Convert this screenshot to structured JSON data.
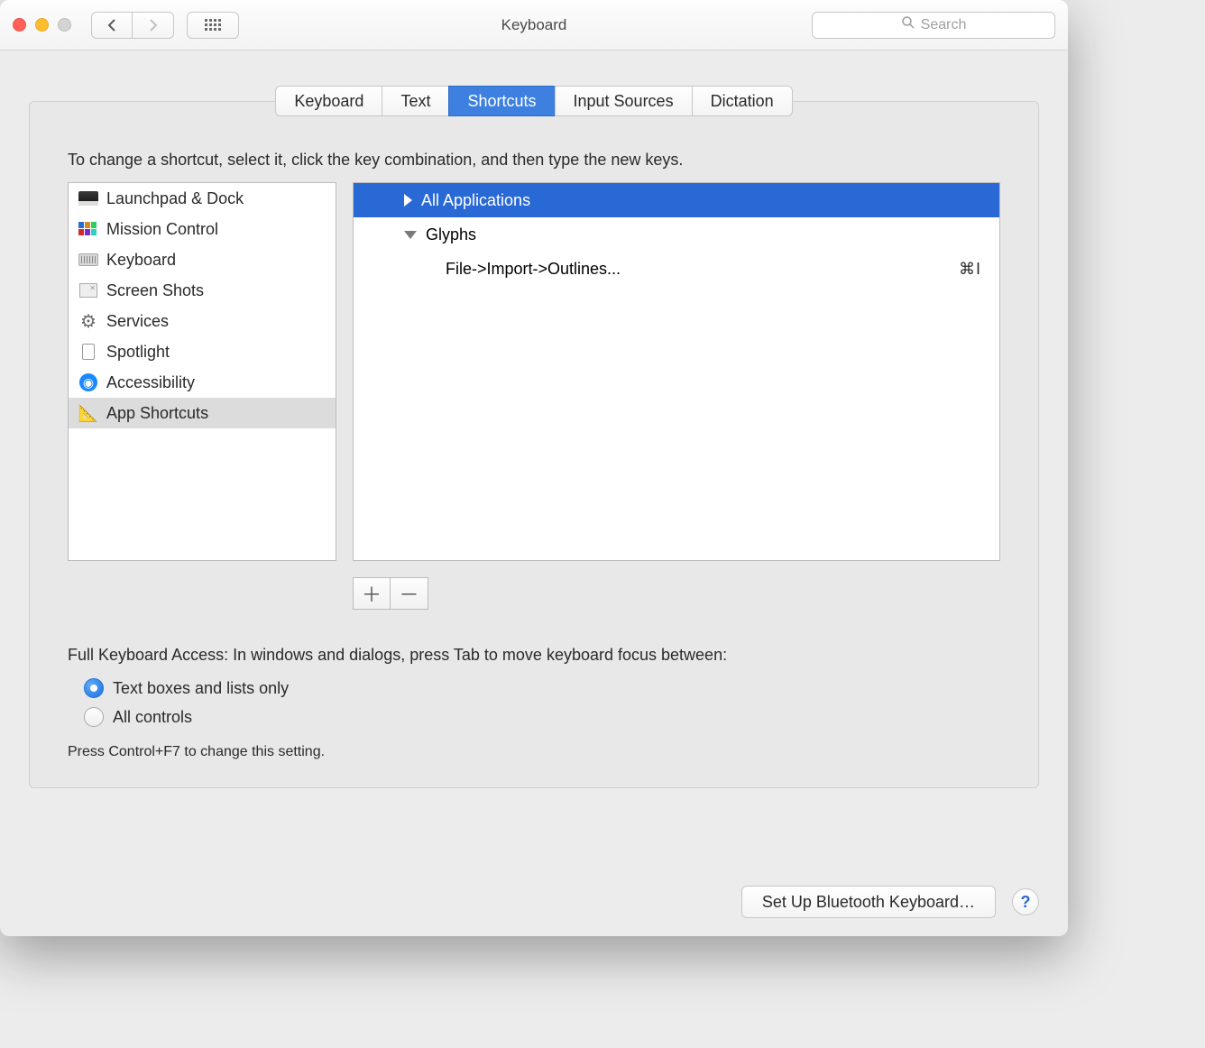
{
  "window": {
    "title": "Keyboard",
    "search_placeholder": "Search"
  },
  "tabs": [
    {
      "label": "Keyboard",
      "active": false
    },
    {
      "label": "Text",
      "active": false
    },
    {
      "label": "Shortcuts",
      "active": true
    },
    {
      "label": "Input Sources",
      "active": false
    },
    {
      "label": "Dictation",
      "active": false
    }
  ],
  "instructions": "To change a shortcut, select it, click the key combination, and then type the new keys.",
  "categories": [
    {
      "label": "Launchpad & Dock",
      "icon": "launchpad",
      "selected": false
    },
    {
      "label": "Mission Control",
      "icon": "mission",
      "selected": false
    },
    {
      "label": "Keyboard",
      "icon": "keyboard",
      "selected": false
    },
    {
      "label": "Screen Shots",
      "icon": "screenshots",
      "selected": false
    },
    {
      "label": "Services",
      "icon": "gear",
      "selected": false
    },
    {
      "label": "Spotlight",
      "icon": "spotlight",
      "selected": false
    },
    {
      "label": "Accessibility",
      "icon": "accessibility",
      "selected": false
    },
    {
      "label": "App Shortcuts",
      "icon": "app",
      "selected": true
    }
  ],
  "tree": {
    "all_apps_label": "All Applications",
    "glyphs_label": "Glyphs",
    "glyphs_item_label": "File->Import->Outlines...",
    "glyphs_item_shortcut": "⌘I"
  },
  "fka": {
    "label": "Full Keyboard Access: In windows and dialogs, press Tab to move keyboard focus between:",
    "option1": "Text boxes and lists only",
    "option2": "All controls",
    "hint": "Press Control+F7 to change this setting."
  },
  "footer": {
    "bluetooth_label": "Set Up Bluetooth Keyboard…",
    "help_label": "?"
  }
}
